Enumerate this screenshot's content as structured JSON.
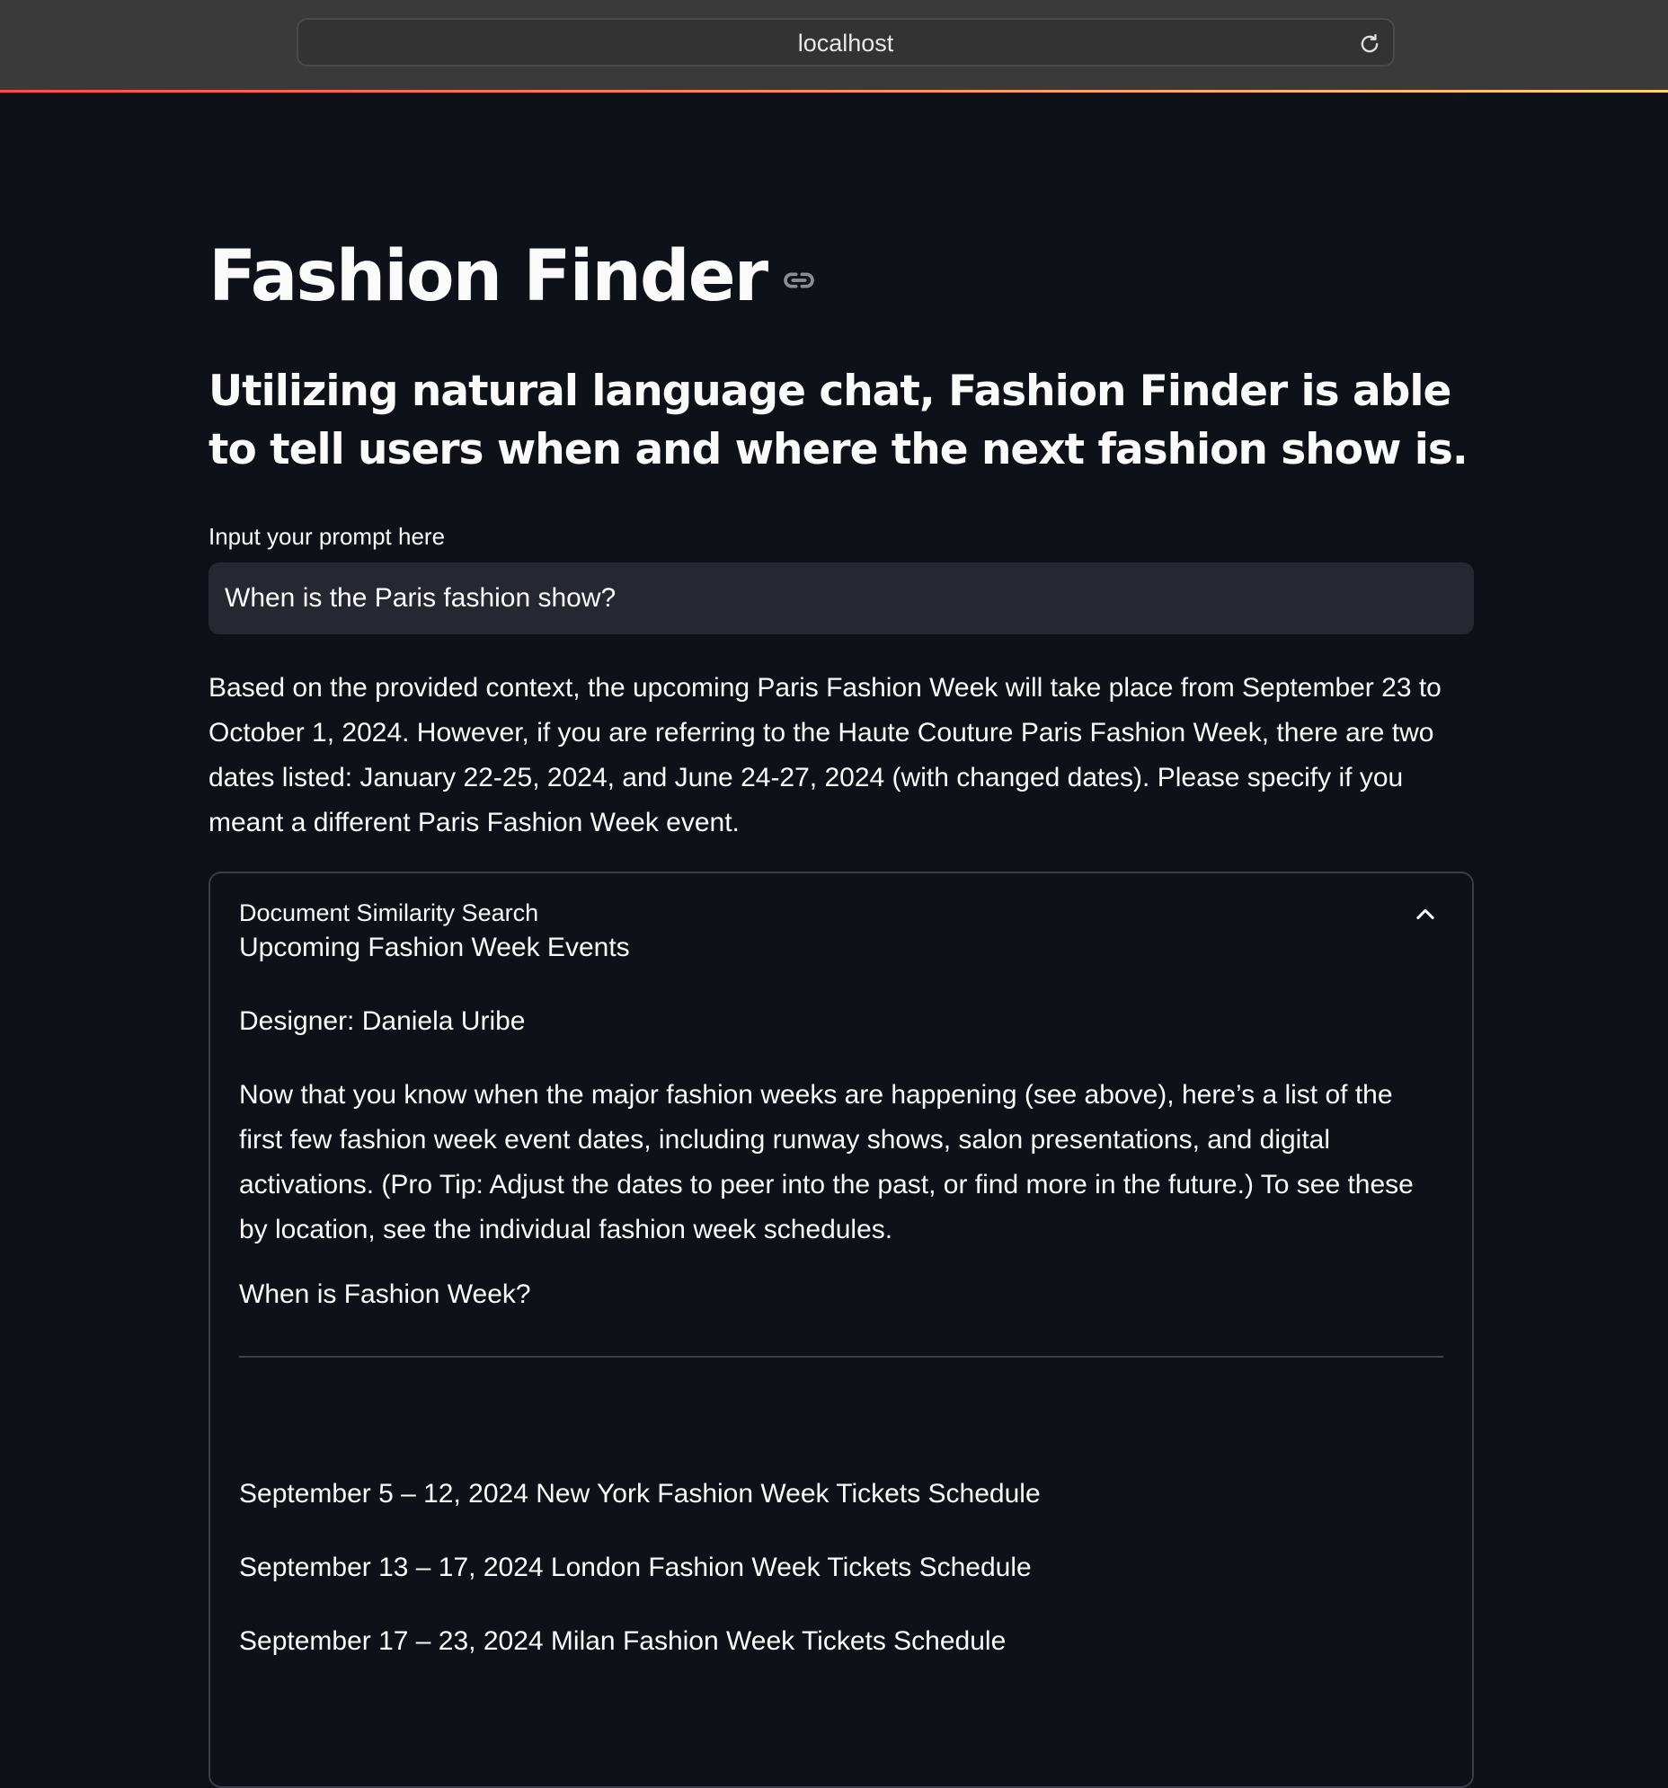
{
  "browser": {
    "address": "localhost"
  },
  "page": {
    "title": "Fashion Finder",
    "subtitle": "Utilizing natural language chat, Fashion Finder is able to tell users when and where the next fashion show is."
  },
  "prompt": {
    "label": "Input your prompt here",
    "value": "When is the Paris fashion show?"
  },
  "answer": "Based on the provided context, the upcoming Paris Fashion Week will take place from September 23 to October 1, 2024. However, if you are referring to the Haute Couture Paris Fashion Week, there are two dates listed: January 22-25, 2024, and June 24-27, 2024 (with changed dates). Please specify if you meant a different Paris Fashion Week event.",
  "expander": {
    "title": "Document Similarity Search",
    "heading": "Upcoming Fashion Week Events",
    "designer": "Designer: Daniela Uribe",
    "intro": "Now that you know when the major fashion weeks are happening (see above), here’s a list of the first few fashion week event dates, including runway shows, salon presentations, and digital activations. (Pro Tip: Adjust the dates to peer into the past, or find more in the future.) To see these by location, see the individual fashion week schedules.",
    "question": "When is Fashion Week?",
    "events": [
      "September 5 – 12, 2024 New York Fashion Week Tickets Schedule",
      "September 13 – 17, 2024 London Fashion Week Tickets Schedule",
      "September 17 – 23, 2024 Milan Fashion Week Tickets Schedule"
    ]
  },
  "colors": {
    "background": "#0e1117",
    "input_background": "#262730",
    "text": "#fafafa",
    "accent_start": "#ff4b4b",
    "accent_end": "#ffd36b"
  },
  "icons": {
    "reload": "reload-icon",
    "anchor": "link-icon",
    "chevron": "chevron-up-icon"
  }
}
